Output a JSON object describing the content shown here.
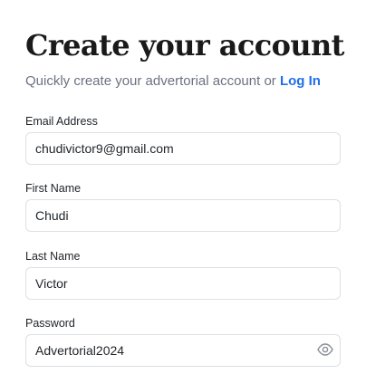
{
  "header": {
    "title": "Create your account",
    "subtitle_prefix": "Quickly create your advertorial account or ",
    "login_link": "Log In"
  },
  "form": {
    "email": {
      "label": "Email Address",
      "value": "chudivictor9@gmail.com"
    },
    "first_name": {
      "label": "First Name",
      "value": "Chudi"
    },
    "last_name": {
      "label": "Last Name",
      "value": "Victor"
    },
    "password": {
      "label": "Password",
      "value": "Advertorial2024",
      "toggle_icon": "eye-icon"
    }
  },
  "colors": {
    "link": "#1f6feb",
    "muted_text": "#6b7280",
    "input_border": "#dde0e4",
    "icon": "#8a8f98"
  }
}
